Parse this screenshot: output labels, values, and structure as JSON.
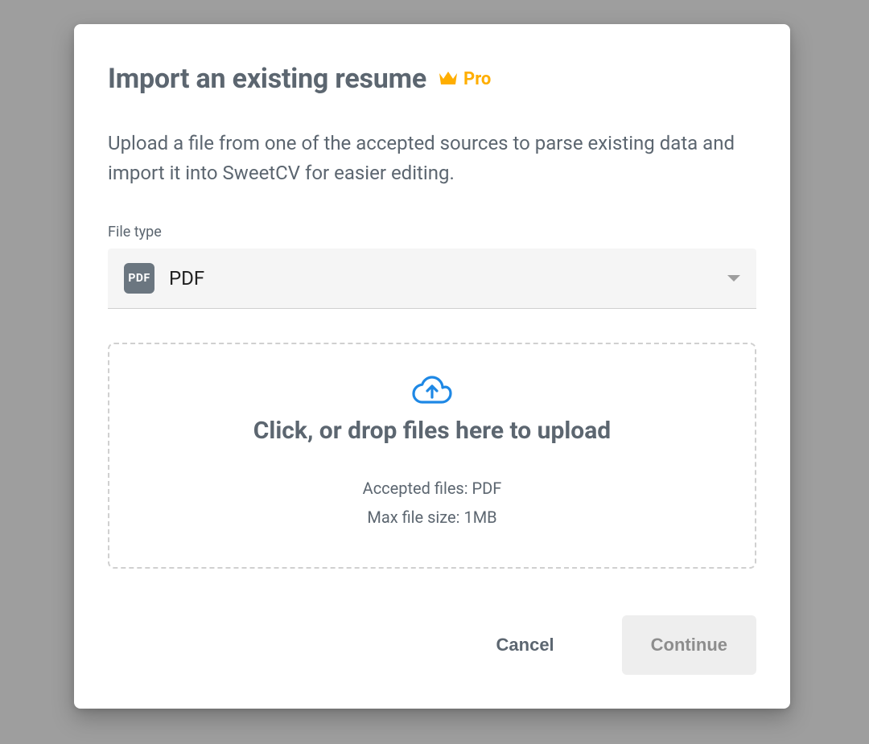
{
  "modal": {
    "title": "Import an existing resume",
    "pro_label": "Pro",
    "description": "Upload a file from one of the accepted sources to parse existing data and import it into SweetCV for easier editing.",
    "file_type": {
      "label": "File type",
      "icon_text": "PDF",
      "selected": "PDF"
    },
    "dropzone": {
      "title": "Click, or drop files here to upload",
      "accepted": "Accepted files: PDF",
      "maxsize": "Max file size: 1MB"
    },
    "buttons": {
      "cancel": "Cancel",
      "continue": "Continue"
    }
  }
}
